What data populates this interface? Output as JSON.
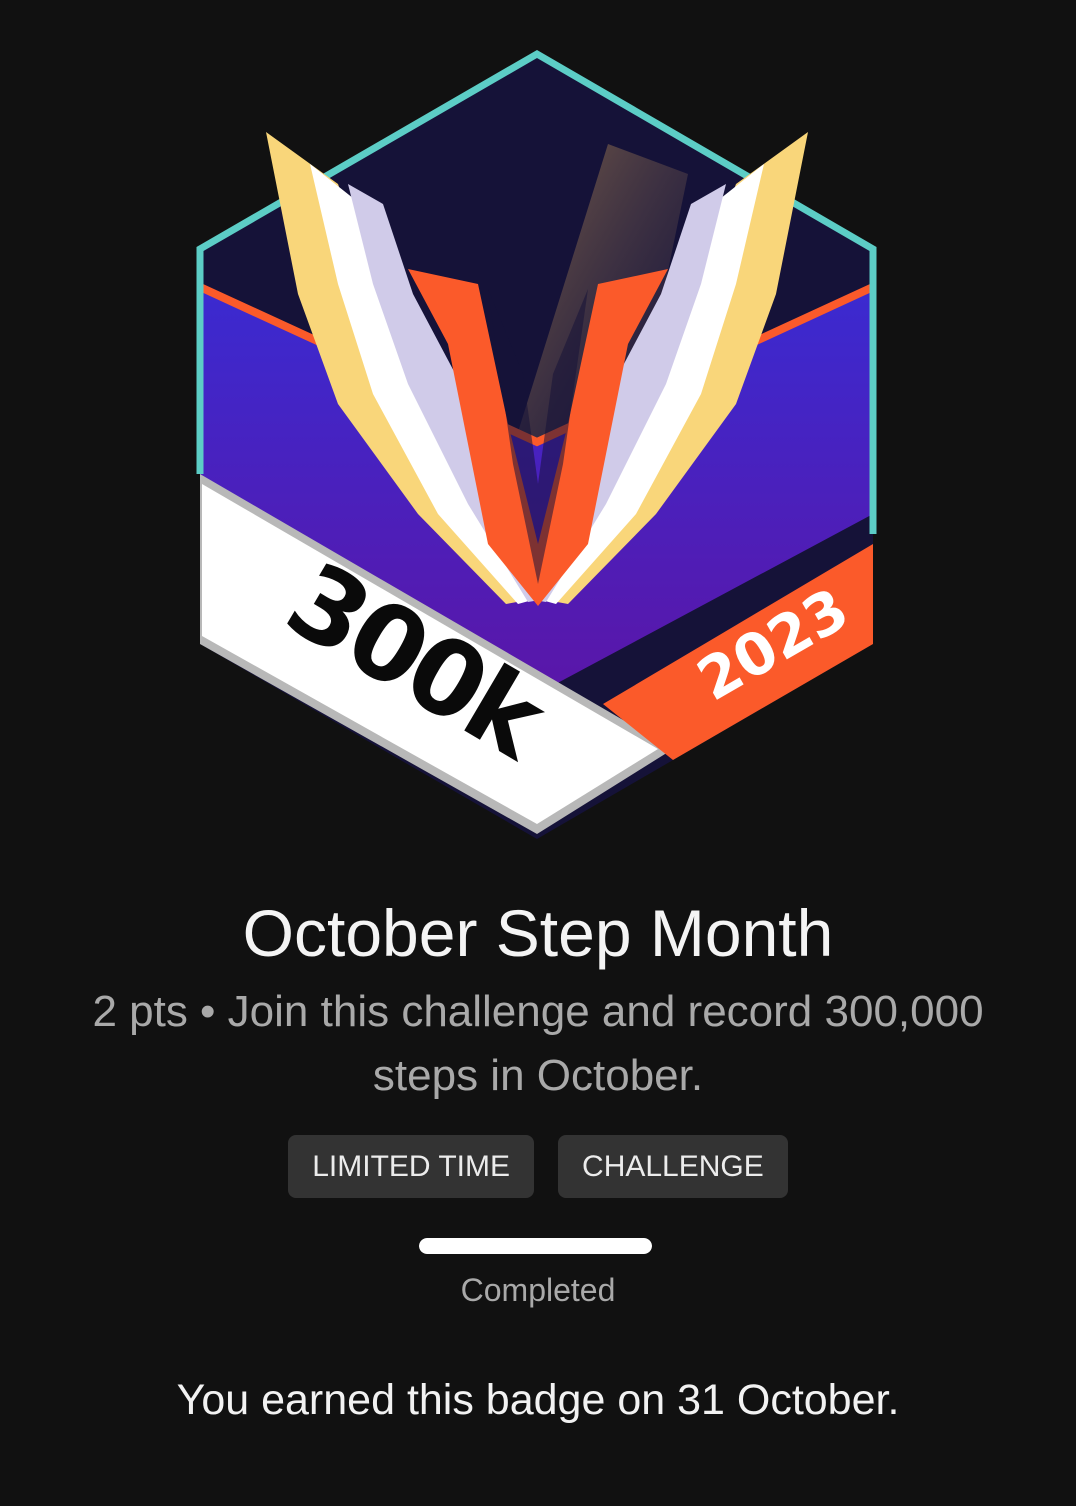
{
  "badge": {
    "image_icon": "hexagon-wings-badge-icon",
    "number_text": "300k",
    "year_text": "2023",
    "colors": {
      "outline": "#5ccdc6",
      "navy": "#151238",
      "purple": "#4a1fb0",
      "orange": "#fb5a2a",
      "yellow": "#f9d67a",
      "lavender": "#d0cbe9",
      "ribbon": "#ffffff"
    }
  },
  "title": "October Step Month",
  "description": "2 pts • Join this challenge and record 300,000 steps in October.",
  "tags": [
    "LIMITED TIME",
    "CHALLENGE"
  ],
  "progress": {
    "fraction": 1.0,
    "status": "Completed"
  },
  "earned_text": "You earned this badge on 31 October."
}
